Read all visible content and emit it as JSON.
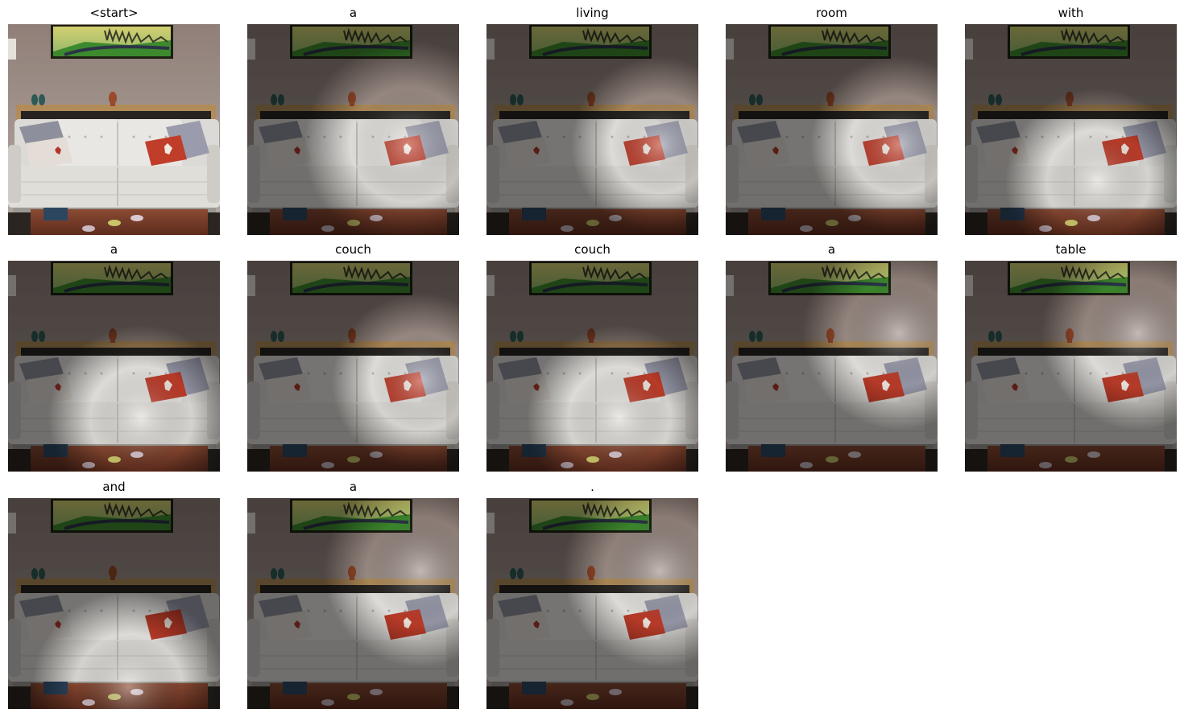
{
  "figure": {
    "panels": [
      {
        "caption": "<start>",
        "attention": null
      },
      {
        "caption": "a",
        "attention": "sofa"
      },
      {
        "caption": "living",
        "attention": "sofa-right"
      },
      {
        "caption": "room",
        "attention": "sofa-right"
      },
      {
        "caption": "with",
        "attention": "sofa-center"
      },
      {
        "caption": "a",
        "attention": "sofa-center"
      },
      {
        "caption": "couch",
        "attention": "sofa-right"
      },
      {
        "caption": "couch",
        "attention": "sofa-center"
      },
      {
        "caption": "a",
        "attention": "wall-right"
      },
      {
        "caption": "table",
        "attention": "wall-right"
      },
      {
        "caption": "and",
        "attention": "floor"
      },
      {
        "caption": "a",
        "attention": "wall-right"
      },
      {
        "caption": ".",
        "attention": "wall-right"
      }
    ]
  }
}
